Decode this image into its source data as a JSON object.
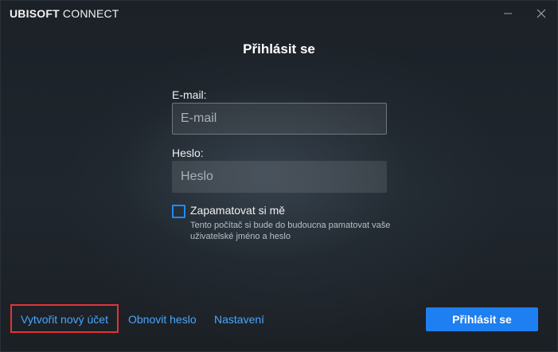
{
  "window": {
    "brand_bold": "UBISOFT",
    "brand_rest": " CONNECT"
  },
  "login": {
    "title": "Přihlásit se",
    "email_label": "E-mail:",
    "email_placeholder": "E-mail",
    "email_value": "",
    "password_label": "Heslo:",
    "password_placeholder": "Heslo",
    "password_value": "",
    "remember_label": "Zapamatovat si mě",
    "remember_checked": false,
    "remember_hint": "Tento počítač si bude do budoucna pamatovat vaše uživatelské jméno a heslo",
    "submit_label": "Přihlásit se"
  },
  "footer": {
    "create_account": "Vytvořit nový účet",
    "reset_password": "Obnovit heslo",
    "settings": "Nastavení"
  },
  "colors": {
    "accent": "#1e7ff0",
    "link": "#4aa6ff",
    "highlight": "#e53237"
  },
  "icons": {
    "minimize": "minimize-icon",
    "close": "close-icon"
  }
}
